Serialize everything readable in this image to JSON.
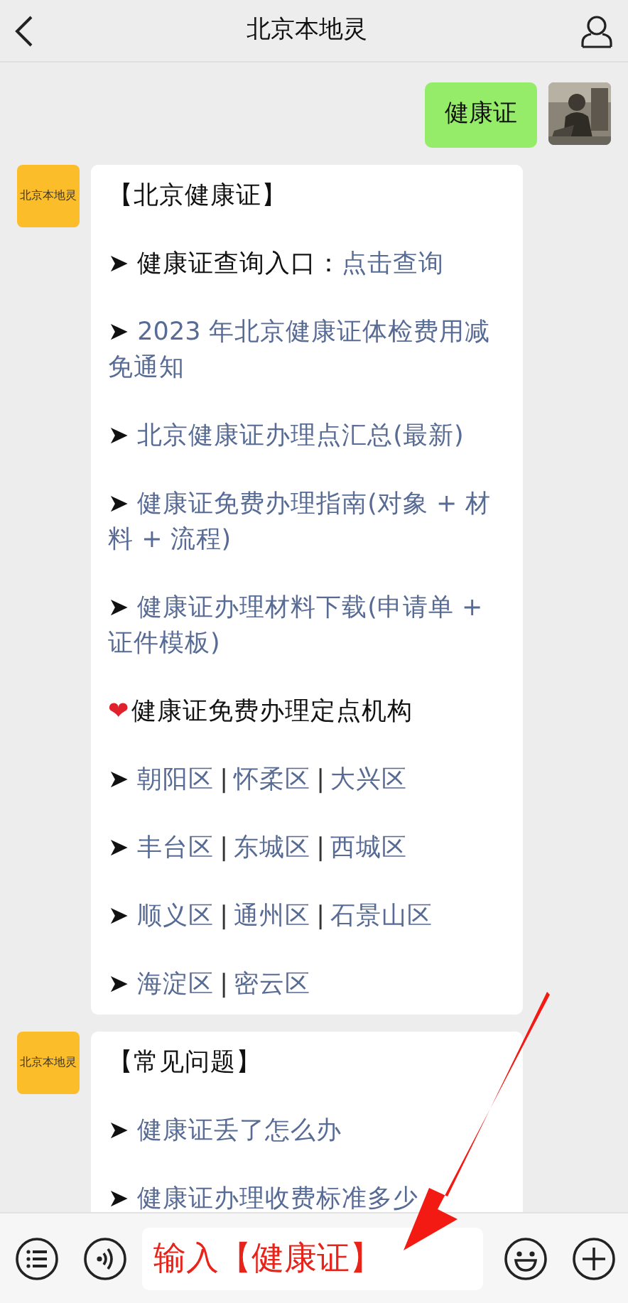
{
  "header": {
    "title": "北京本地灵"
  },
  "messages": [
    {
      "outgoing": true,
      "kind": "text",
      "text": "健康证"
    },
    {
      "outgoing": false,
      "kind": "card",
      "avatar_text": "北京本地灵",
      "lines": [
        {
          "parts": [
            {
              "kind": "text",
              "text": "【北京健康证】"
            }
          ]
        },
        {
          "bullet": "➤",
          "parts": [
            {
              "kind": "text",
              "text": "健康证查询入口："
            },
            {
              "kind": "link",
              "text": "点击查询"
            }
          ]
        },
        {
          "bullet": "➤",
          "parts": [
            {
              "kind": "link",
              "text": "2023 年北京健康证体检费用减免通知"
            }
          ]
        },
        {
          "bullet": "➤",
          "parts": [
            {
              "kind": "link",
              "text": "北京健康证办理点汇总(最新)"
            }
          ]
        },
        {
          "bullet": "➤",
          "parts": [
            {
              "kind": "link",
              "text": "健康证免费办理指南(对象 + 材料 + 流程)"
            }
          ]
        },
        {
          "bullet": "➤",
          "parts": [
            {
              "kind": "link",
              "text": "健康证办理材料下载(申请单 + 证件模板)"
            }
          ]
        },
        {
          "bullet": "❤",
          "parts": [
            {
              "kind": "text",
              "text": "健康证免费办理定点机构"
            }
          ]
        },
        {
          "bullet": "➤",
          "parts": [
            {
              "kind": "link",
              "text": "朝阳区"
            },
            {
              "kind": "sep",
              "text": "|"
            },
            {
              "kind": "link",
              "text": "怀柔区"
            },
            {
              "kind": "sep",
              "text": "|"
            },
            {
              "kind": "link",
              "text": "大兴区"
            }
          ]
        },
        {
          "bullet": "➤",
          "parts": [
            {
              "kind": "link",
              "text": "丰台区"
            },
            {
              "kind": "sep",
              "text": "|"
            },
            {
              "kind": "link",
              "text": "东城区"
            },
            {
              "kind": "sep",
              "text": "|"
            },
            {
              "kind": "link",
              "text": "西城区"
            }
          ]
        },
        {
          "bullet": "➤",
          "parts": [
            {
              "kind": "link",
              "text": "顺义区"
            },
            {
              "kind": "sep",
              "text": "|"
            },
            {
              "kind": "link",
              "text": "通州区"
            },
            {
              "kind": "sep",
              "text": "|"
            },
            {
              "kind": "link",
              "text": "石景山区"
            }
          ]
        },
        {
          "bullet": "➤",
          "parts": [
            {
              "kind": "link",
              "text": "海淀区"
            },
            {
              "kind": "sep",
              "text": "|"
            },
            {
              "kind": "link",
              "text": "密云区"
            }
          ]
        }
      ]
    },
    {
      "outgoing": false,
      "kind": "card",
      "avatar_text": "北京本地灵",
      "lines": [
        {
          "parts": [
            {
              "kind": "text",
              "text": "【常见问题】"
            }
          ]
        },
        {
          "bullet": "➤",
          "parts": [
            {
              "kind": "link",
              "text": "健康证丢了怎么办"
            }
          ]
        },
        {
          "bullet": "➤",
          "parts": [
            {
              "kind": "link",
              "text": "健康证办理收费标准多少"
            }
          ]
        }
      ]
    }
  ],
  "composer": {
    "value": "输入【健康证】"
  }
}
